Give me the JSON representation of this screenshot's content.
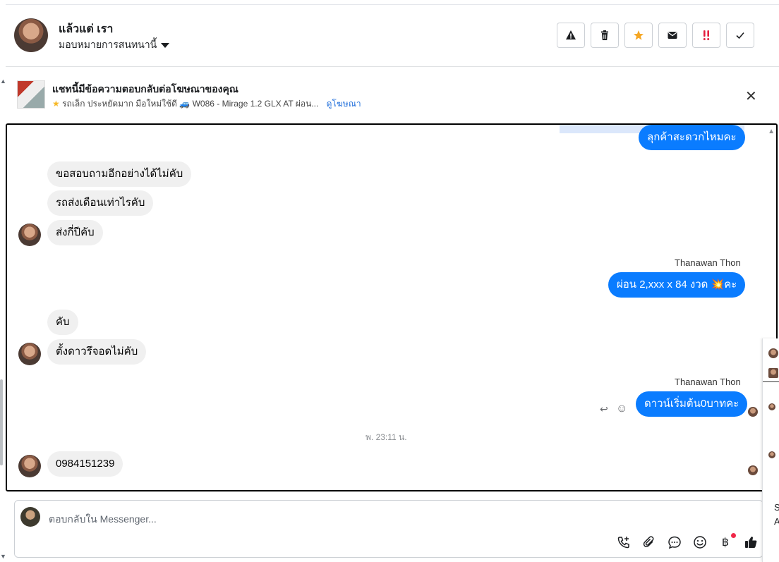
{
  "header": {
    "contact_name": "แล้วแต่ เรา",
    "assign_label": "มอบหมายการสนทนานี้",
    "actions": [
      {
        "name": "alert-icon",
        "symbol": "⚠"
      },
      {
        "name": "trash-icon",
        "symbol": "🗑"
      },
      {
        "name": "star-icon",
        "symbol": "★"
      },
      {
        "name": "mail-icon",
        "symbol": "✉"
      },
      {
        "name": "urgent-icon",
        "symbol": "‼"
      },
      {
        "name": "check-icon",
        "symbol": "✓"
      }
    ]
  },
  "ad_banner": {
    "title": "แชทนี้มีข้อความตอบกลับต่อโฆษณาของคุณ",
    "subtitle": "รถเล็ก ประหยัดมาก มือใหม่ใช้ดี 🚙 W086 - Mirage 1.2 GLX AT ผ่อน...",
    "link": "ดูโฆษณา",
    "close": "✕"
  },
  "thread": {
    "messages": [
      {
        "id": "m1",
        "dir": "out",
        "text": "ลุกค้าสะดวกไหมคะ"
      },
      {
        "id": "m2",
        "dir": "in",
        "text": "ขอสอบถามอีกอย่างได้ไม่คับ"
      },
      {
        "id": "m3",
        "dir": "in",
        "text": "รถส่งเดือนเท่าไรคับ"
      },
      {
        "id": "m4",
        "dir": "in",
        "text": "ส่งกี่ปีคับ"
      },
      {
        "id": "m5",
        "dir": "out",
        "sender": "Thanawan Thon",
        "text": "ผ่อน 2,xxx x 84 งวด 💥คะ"
      },
      {
        "id": "m6",
        "dir": "in",
        "text": "คับ"
      },
      {
        "id": "m7",
        "dir": "in",
        "text": "ตั้งดาวรึจอดไม่คับ"
      },
      {
        "id": "m8",
        "dir": "out",
        "sender": "Thanawan Thon",
        "text": "ดาวน์เริ่มต้น0บาทคะ"
      },
      {
        "id": "m9",
        "dir": "in",
        "text": "0984151239"
      }
    ],
    "timestamp": "พ. 23:11 น."
  },
  "composer": {
    "placeholder": "ตอบกลับใน Messenger...",
    "tools": [
      "call-add-icon",
      "attach-icon",
      "chat-icon",
      "emoji-icon",
      "baht-icon",
      "like-icon"
    ]
  },
  "side_panel": {
    "letters": [
      "S",
      "A"
    ]
  }
}
